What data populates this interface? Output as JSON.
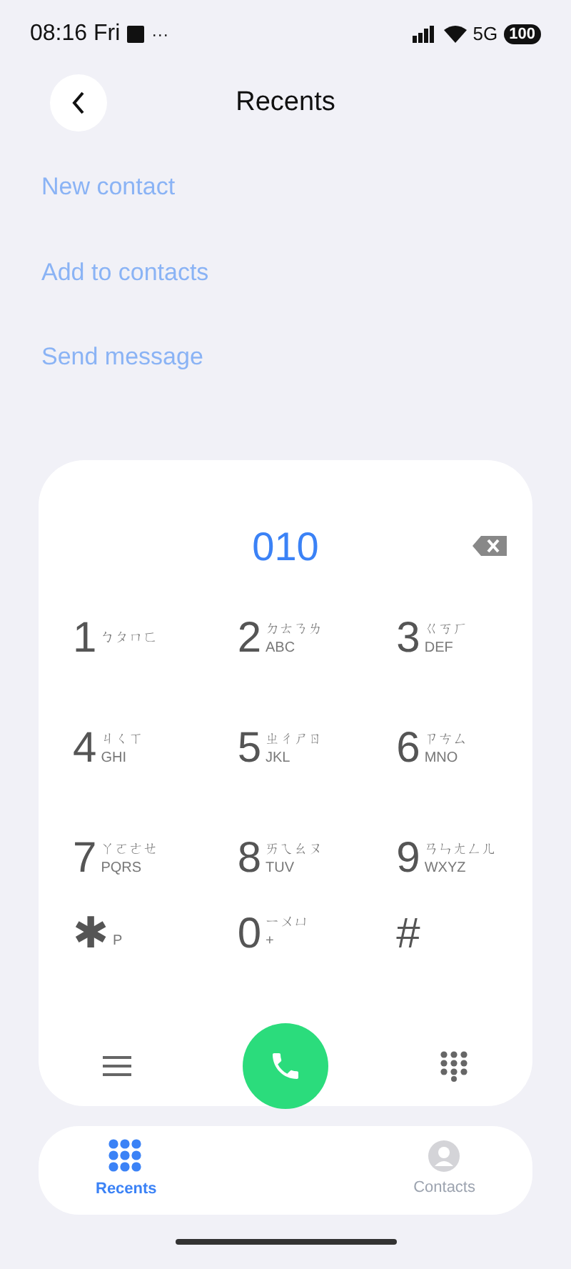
{
  "status_bar": {
    "time": "08:16 Fri",
    "more": "···",
    "network": "5G",
    "battery": "100"
  },
  "header": {
    "title": "Recents"
  },
  "actions": [
    "New contact",
    "Add to contacts",
    "Send message"
  ],
  "dialer": {
    "number": "010",
    "keys": [
      {
        "digit": "1",
        "zhuyin": "ㄅㄆㄇㄈ"
      },
      {
        "digit": "2",
        "zhuyin": "ㄉㄊㄋㄌ",
        "letters": "ABC"
      },
      {
        "digit": "3",
        "zhuyin": "ㄍㄎㄏ",
        "letters": "DEF"
      },
      {
        "digit": "4",
        "zhuyin": "ㄐㄑㄒ",
        "letters": "GHI"
      },
      {
        "digit": "5",
        "zhuyin": "ㄓㄔㄕㄖ",
        "letters": "JKL"
      },
      {
        "digit": "6",
        "zhuyin": "ㄗㄘㄙ",
        "letters": "MNO"
      },
      {
        "digit": "7",
        "zhuyin": "ㄚㄛㄜㄝ",
        "letters": "PQRS"
      },
      {
        "digit": "8",
        "zhuyin": "ㄞㄟㄠㄡ",
        "letters": "TUV"
      },
      {
        "digit": "9",
        "zhuyin": "ㄢㄣㄤㄥㄦ",
        "letters": "WXYZ"
      },
      {
        "digit": "✱",
        "letters": "P"
      },
      {
        "digit": "0",
        "zhuyin": "ㄧㄨㄩ",
        "letters": "+"
      },
      {
        "digit": "#"
      }
    ]
  },
  "tabs": [
    {
      "label": "Recents",
      "selected": true,
      "kind": "grid"
    },
    {
      "label": "Contacts",
      "selected": false,
      "kind": "person"
    }
  ]
}
